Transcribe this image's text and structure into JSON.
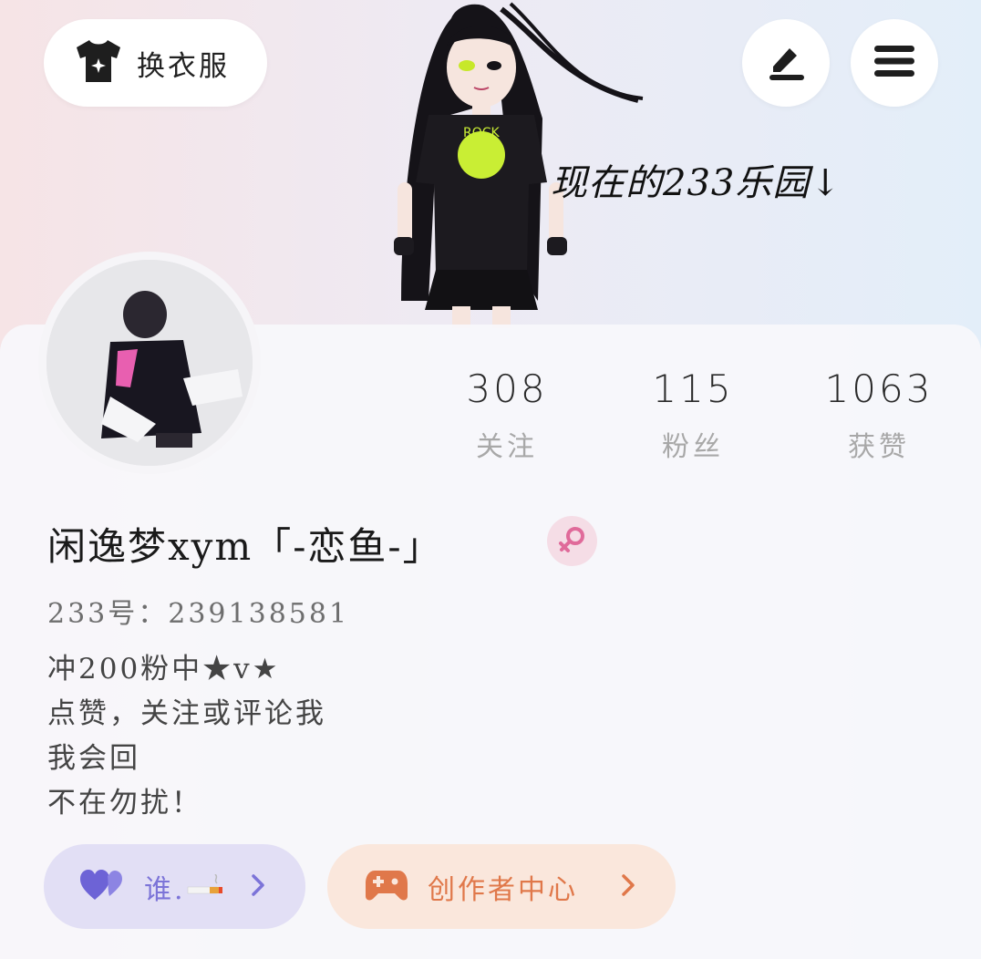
{
  "header": {
    "outfit_label": "换衣服",
    "edit_icon": "edit-icon",
    "menu_icon": "menu-icon"
  },
  "banner": {
    "caption": "现在的233乐园↓"
  },
  "stats": [
    {
      "value": "308",
      "label": "关注"
    },
    {
      "value": "115",
      "label": "粉丝"
    },
    {
      "value": "1063",
      "label": "获赞"
    }
  ],
  "profile": {
    "username": "闲逸梦xym「-恋鱼-」",
    "gender_icon": "female-icon",
    "uid": "233号：239138581",
    "bio_lines": [
      "冲200粉中★v★",
      "点赞，关注或评论我",
      "我会回",
      "不在勿扰！"
    ]
  },
  "actions": {
    "who_label": "谁.",
    "creator_label": "创作者中心"
  },
  "colors": {
    "who_accent": "#7c74d8",
    "creator_accent": "#e0784a",
    "female_accent": "#e06a9a"
  }
}
